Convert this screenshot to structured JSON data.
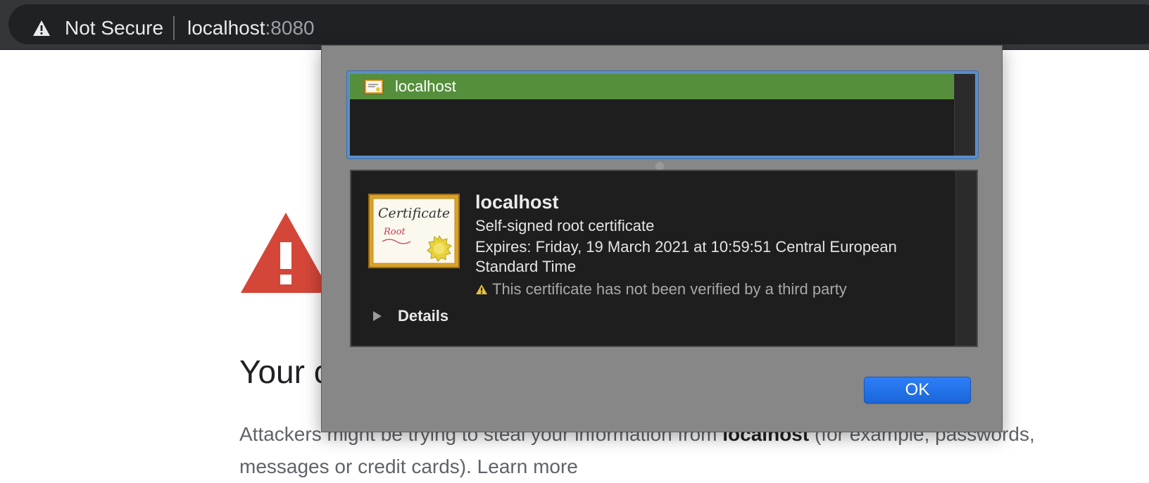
{
  "browser": {
    "security_label": "Not Secure",
    "url_host": "localhost",
    "url_port": ":8080"
  },
  "page": {
    "heading": "Your c",
    "body_before": "Attackers might be trying to steal your information from ",
    "body_host": "localhost",
    "body_after": " (for example, passwords,",
    "body_line2": "messages or credit cards). ",
    "learn_more": "Learn more"
  },
  "dialog": {
    "list": [
      {
        "label": "localhost",
        "selected": true
      }
    ],
    "cert": {
      "name": "localhost",
      "type": "Self-signed root certificate",
      "expiry": "Expires: Friday, 19 March 2021 at 10:59:51 Central European Standard Time",
      "warning": "This certificate has not been verified by a third party",
      "icon_title": "Certificate",
      "icon_subtitle": "Root"
    },
    "details_label": "Details",
    "ok_label": "OK"
  },
  "colors": {
    "selection_green": "#558f3b",
    "focus_ring": "#5b8ec6",
    "ok_blue": "#1b66d9",
    "warning_red": "#d44638"
  }
}
